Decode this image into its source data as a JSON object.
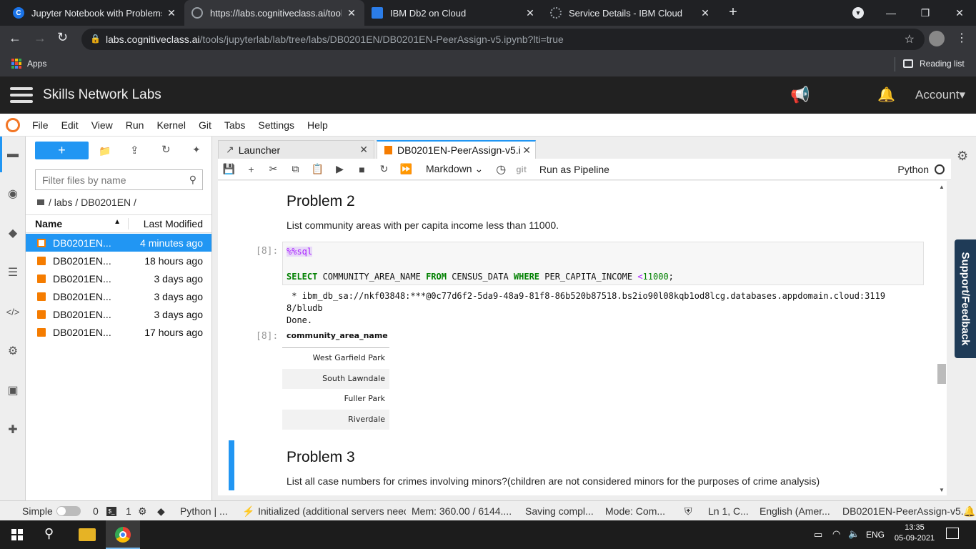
{
  "browser": {
    "tabs": [
      {
        "title": "Jupyter Notebook with Problems",
        "favicon": "cc-icon",
        "active": false
      },
      {
        "title": "https://labs.cognitiveclass.ai/tools/",
        "favicon": "globe-icon",
        "active": true
      },
      {
        "title": "IBM Db2 on Cloud",
        "favicon": "db2-icon",
        "active": false
      },
      {
        "title": "Service Details - IBM Cloud",
        "favicon": "ibmcloud-icon",
        "active": false
      }
    ],
    "url_host": "labs.cognitiveclass.ai",
    "url_path": "/tools/jupyterlab/lab/tree/labs/DB0201EN/DB0201EN-PeerAssign-v5.ipynb?lti=true",
    "bookmarks_apps": "Apps",
    "reading_list": "Reading list"
  },
  "sn_header": {
    "title": "Skills Network Labs",
    "account": "Account"
  },
  "menu": [
    "File",
    "Edit",
    "View",
    "Run",
    "Kernel",
    "Git",
    "Tabs",
    "Settings",
    "Help"
  ],
  "filebrowser": {
    "new_label": "+",
    "filter_placeholder": "Filter files by name",
    "breadcrumb": "/ labs / DB0201EN /",
    "col_name": "Name",
    "col_modified": "Last Modified",
    "files": [
      {
        "name": "DB0201EN...",
        "modified": "4 minutes ago",
        "selected": true
      },
      {
        "name": "DB0201EN...",
        "modified": "18 hours ago",
        "selected": false
      },
      {
        "name": "DB0201EN...",
        "modified": "3 days ago",
        "selected": false
      },
      {
        "name": "DB0201EN...",
        "modified": "3 days ago",
        "selected": false
      },
      {
        "name": "DB0201EN...",
        "modified": "3 days ago",
        "selected": false
      },
      {
        "name": "DB0201EN...",
        "modified": "17 hours ago",
        "selected": false
      }
    ]
  },
  "notebook": {
    "tab_launcher": "Launcher",
    "tab_notebook": "DB0201EN-PeerAssign-v5.i",
    "cell_type": "Markdown",
    "git_label": "git",
    "run_pipeline": "Run as Pipeline",
    "kernel": "Python",
    "problem2_title": "Problem 2",
    "problem2_text": "List community areas with per capita income less than 11000.",
    "prompt_in": "[8]:",
    "code_magic": "%%sql",
    "code_kw1": "SELECT",
    "code_t1": " COMMUNITY_AREA_NAME ",
    "code_kw2": "FROM",
    "code_t2": " CENSUS_DATA ",
    "code_kw3": "WHERE",
    "code_t3": " PER_CAPITA_INCOME ",
    "code_op": "<",
    "code_num": "11000",
    "code_end": ";",
    "output_line1": " * ibm_db_sa://nkf03848:***@0c77d6f2-5da9-48a9-81f8-86b520b87518.bs2io90l08kqb1od8lcg.databases.appdomain.cloud:3119",
    "output_line2": "8/bludb",
    "output_line3": "Done.",
    "prompt_out": "[8]:",
    "table_header": "community_area_name",
    "table_rows": [
      "West Garfield Park",
      "South Lawndale",
      "Fuller Park",
      "Riverdale"
    ],
    "problem3_title": "Problem 3",
    "problem3_text": "List all case numbers for crimes involving minors?(children are not considered minors for the purposes of crime analysis)"
  },
  "support_label": "Support/Feedback",
  "statusbar": {
    "mode": "Simple",
    "terminals": "0",
    "kernels": "1",
    "kernel_name": "Python | ...",
    "lsp": "Initialized (additional servers neec",
    "mem": "Mem: 360.00 / 6144....",
    "saving": "Saving compl...",
    "edit_mode": "Mode: Com...",
    "cursor": "Ln 1, C...",
    "lang": "English (Amer...",
    "file": "DB0201EN-PeerAssign-v5..."
  },
  "taskbar": {
    "lang": "ENG",
    "time": "13:35",
    "date": "05-09-2021"
  },
  "colors": {
    "jupyter_blue": "#2196f3",
    "selected_row": "#2196f3",
    "sql_keyword": "#008000",
    "sql_magic_bg": "#e8d9f8"
  }
}
